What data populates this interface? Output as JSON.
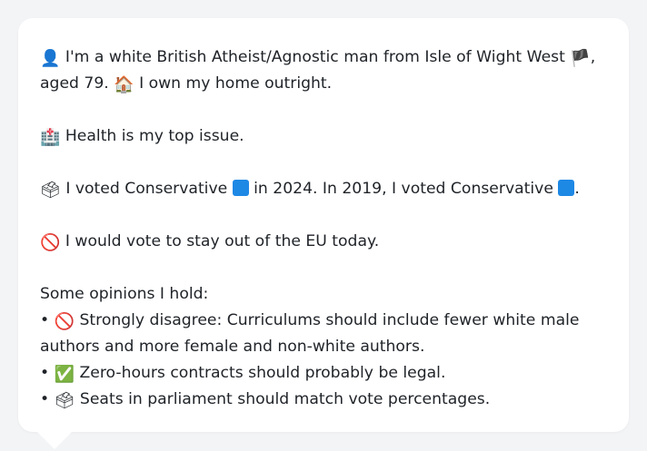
{
  "profile": {
    "line1": {
      "icon": "👤",
      "text": " I'm a white British Atheist/Agnostic man from Isle of Wight West ",
      "flag": "🏴",
      "end": ","
    },
    "line2": {
      "text_a": "aged 79. ",
      "icon": "🏠",
      "text_b": " I own my home outright."
    },
    "health": {
      "icon": "🏥",
      "text": " Health is my top issue."
    },
    "vote": {
      "icon": "🗳",
      "text_a": " I voted Conservative ",
      "text_b": " in 2024. In 2019, I voted Conservative ",
      "end": ".",
      "party_color": "#1e88e5"
    },
    "eu": {
      "icon": "🚫",
      "text": " I would vote to stay out of the EU today."
    },
    "opinions": {
      "heading": "Some opinions I hold:",
      "items": [
        {
          "bullet": "• ",
          "icon": "🚫",
          "text": " Strongly disagree: Curriculums should include fewer white male authors and more female and non-white authors."
        },
        {
          "bullet": "• ",
          "icon": "✅",
          "text": " Zero-hours contracts should probably be legal."
        },
        {
          "bullet": "• ",
          "icon": "🗳",
          "text": " Seats in parliament should match vote percentages."
        }
      ]
    }
  }
}
